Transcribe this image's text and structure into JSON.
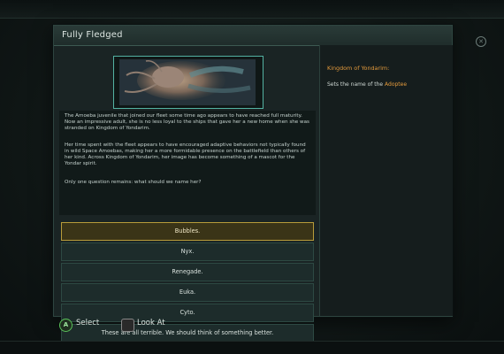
{
  "window": {
    "title": "Fully Fledged"
  },
  "event": {
    "paragraphs": [
      "The Amoeba juvenile that joined our fleet some time ago appears to have reached full maturity. Now an impressive adult, she is no less loyal to the ships that gave her a new home when she was stranded on Kingdom of Yondarim.",
      "Her time spent with the fleet appears to have encouraged adaptive behaviors not typically found in wild Space Amoebas, making her a more formidable presence on the battlefield than others of her kind. Across Kingdom of Yondarim, her image has become something of a mascot for the Yondar spirit.",
      "Only one question remains: what should we name her?"
    ],
    "portrait_icon": "space-amoeba-image"
  },
  "options": [
    {
      "label": "Bubbles.",
      "selected": true
    },
    {
      "label": "Nyx.",
      "selected": false
    },
    {
      "label": "Renegade.",
      "selected": false
    },
    {
      "label": "Euka.",
      "selected": false
    },
    {
      "label": "Cyto.",
      "selected": false
    },
    {
      "label": "These are all terrible. We should think of something better.",
      "selected": false
    }
  ],
  "info_panel": {
    "title": "Kingdom of Yondarim:",
    "text_prefix": "Sets the name of the ",
    "text_highlight": "Adoptee"
  },
  "controls": {
    "select_button": "A",
    "select_label": "Select",
    "look_label": "Look At"
  },
  "colors": {
    "accent_orange": "#e39a3c",
    "frame_teal": "#53b2a2",
    "selected_gold": "#b79b3a"
  }
}
